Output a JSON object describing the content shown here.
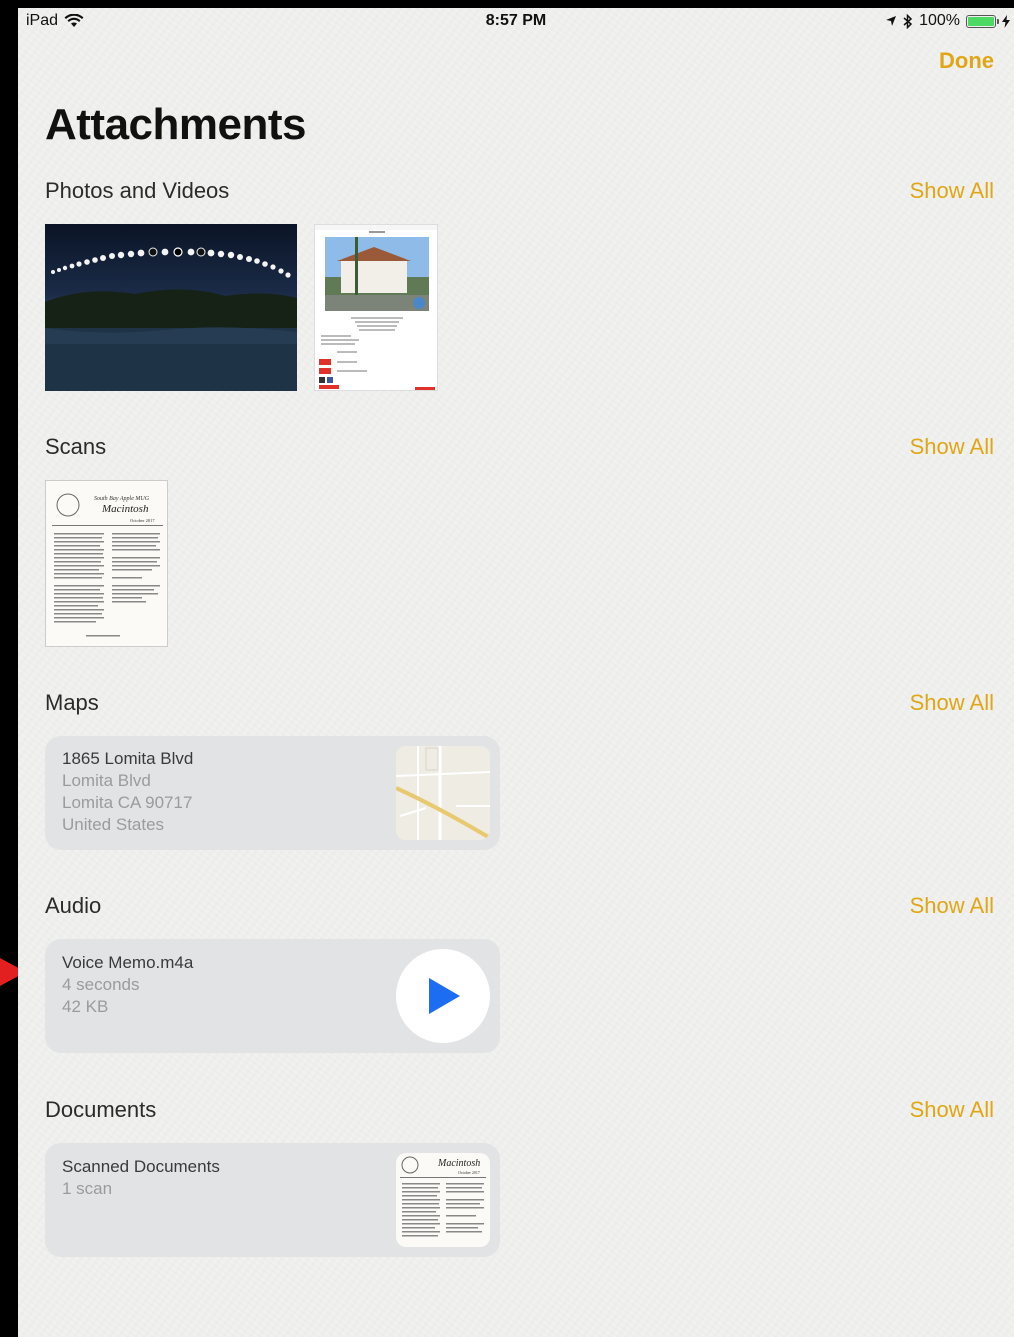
{
  "status": {
    "device": "iPad",
    "time": "8:57 PM",
    "battery": "100%",
    "battery_level": 1.0
  },
  "nav": {
    "done_label": "Done"
  },
  "page_title": "Attachments",
  "sections": {
    "photos": {
      "title": "Photos and Videos",
      "show_all": "Show All"
    },
    "scans": {
      "title": "Scans",
      "show_all": "Show All"
    },
    "maps": {
      "title": "Maps",
      "show_all": "Show All",
      "item": {
        "line1": "1865 Lomita Blvd",
        "line2": "Lomita Blvd",
        "line3": "Lomita CA 90717",
        "line4": "United States"
      }
    },
    "audio": {
      "title": "Audio",
      "show_all": "Show All",
      "item": {
        "name": "Voice Memo.m4a",
        "duration": "4 seconds",
        "size": "42 KB"
      }
    },
    "documents": {
      "title": "Documents",
      "show_all": "Show All",
      "item": {
        "name": "Scanned Documents",
        "count": "1 scan"
      }
    }
  },
  "scan_thumb": {
    "header": "South Bay Apple MUG",
    "title": "Macintosh",
    "date": "October 2017"
  },
  "doc_thumb": {
    "title": "Macintosh",
    "date": "October 2017"
  },
  "colors": {
    "accent": "#e0a615",
    "play": "#1d6df3",
    "arrow": "#e32020"
  }
}
